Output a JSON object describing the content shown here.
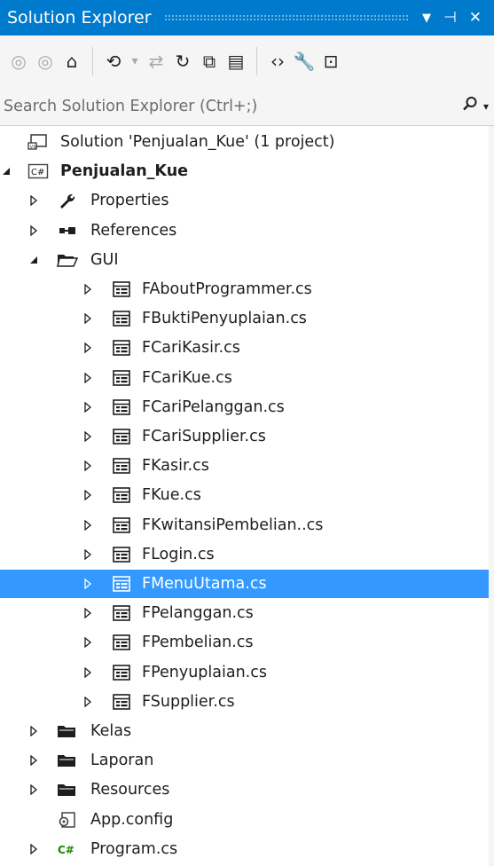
{
  "window": {
    "title": "Solution Explorer",
    "buttons": [
      {
        "name": "dropdown-icon",
        "glyph": "▼"
      },
      {
        "name": "pin-icon",
        "glyph": "⊣"
      },
      {
        "name": "close-icon",
        "glyph": "✕"
      }
    ]
  },
  "toolbar": {
    "items": [
      {
        "name": "back-icon",
        "glyph": "◎",
        "dim": true
      },
      {
        "name": "forward-icon",
        "glyph": "◎",
        "dim": true
      },
      {
        "name": "home-icon",
        "glyph": "⌂",
        "dim": false
      },
      {
        "sep": true
      },
      {
        "name": "pending-changes-filter-icon",
        "glyph": "⟲",
        "dim": false
      },
      {
        "name": "dropdown-arrow-icon",
        "glyph": "▾",
        "dim": true
      },
      {
        "name": "sync-with-document-icon",
        "glyph": "⇄",
        "dim": true
      },
      {
        "name": "refresh-icon",
        "glyph": "↻",
        "dim": false
      },
      {
        "name": "collapse-all-icon",
        "glyph": "⧉",
        "dim": false
      },
      {
        "name": "show-all-files-icon",
        "glyph": "▤",
        "dim": false
      },
      {
        "sep": true
      },
      {
        "name": "view-code-icon",
        "glyph": "‹›",
        "dim": false
      },
      {
        "name": "properties-icon",
        "glyph": "🔧",
        "dim": false
      },
      {
        "name": "preview-icon",
        "glyph": "⊡",
        "dim": false
      }
    ]
  },
  "search": {
    "placeholder": "Search Solution Explorer (Ctrl+;)",
    "value": ""
  },
  "tree": [
    {
      "label": "Solution 'Penjualan_Kue' (1 project)",
      "level": 0,
      "icon": "solution",
      "expander": "none",
      "bold": false,
      "selected": false
    },
    {
      "label": "Penjualan_Kue",
      "level": 0,
      "icon": "csproj",
      "expander": "expanded",
      "bold": true,
      "selected": false
    },
    {
      "label": "Properties",
      "level": 1,
      "icon": "wrench",
      "expander": "collapsed",
      "bold": false,
      "selected": false
    },
    {
      "label": "References",
      "level": 1,
      "icon": "references",
      "expander": "collapsed",
      "bold": false,
      "selected": false
    },
    {
      "label": "GUI",
      "level": 1,
      "icon": "folder-open",
      "expander": "expanded",
      "bold": false,
      "selected": false
    },
    {
      "label": "FAboutProgrammer.cs",
      "level": 2,
      "icon": "form",
      "expander": "collapsed",
      "bold": false,
      "selected": false
    },
    {
      "label": "FBuktiPenyuplaian.cs",
      "level": 2,
      "icon": "form",
      "expander": "collapsed",
      "bold": false,
      "selected": false
    },
    {
      "label": "FCariKasir.cs",
      "level": 2,
      "icon": "form",
      "expander": "collapsed",
      "bold": false,
      "selected": false
    },
    {
      "label": "FCariKue.cs",
      "level": 2,
      "icon": "form",
      "expander": "collapsed",
      "bold": false,
      "selected": false
    },
    {
      "label": "FCariPelanggan.cs",
      "level": 2,
      "icon": "form",
      "expander": "collapsed",
      "bold": false,
      "selected": false
    },
    {
      "label": "FCariSupplier.cs",
      "level": 2,
      "icon": "form",
      "expander": "collapsed",
      "bold": false,
      "selected": false
    },
    {
      "label": "FKasir.cs",
      "level": 2,
      "icon": "form",
      "expander": "collapsed",
      "bold": false,
      "selected": false
    },
    {
      "label": "FKue.cs",
      "level": 2,
      "icon": "form",
      "expander": "collapsed",
      "bold": false,
      "selected": false
    },
    {
      "label": "FKwitansiPembelian..cs",
      "level": 2,
      "icon": "form",
      "expander": "collapsed",
      "bold": false,
      "selected": false
    },
    {
      "label": "FLogin.cs",
      "level": 2,
      "icon": "form",
      "expander": "collapsed",
      "bold": false,
      "selected": false
    },
    {
      "label": "FMenuUtama.cs",
      "level": 2,
      "icon": "form",
      "expander": "collapsed",
      "bold": false,
      "selected": true
    },
    {
      "label": "FPelanggan.cs",
      "level": 2,
      "icon": "form",
      "expander": "collapsed",
      "bold": false,
      "selected": false
    },
    {
      "label": "FPembelian.cs",
      "level": 2,
      "icon": "form",
      "expander": "collapsed",
      "bold": false,
      "selected": false
    },
    {
      "label": "FPenyuplaian.cs",
      "level": 2,
      "icon": "form",
      "expander": "collapsed",
      "bold": false,
      "selected": false
    },
    {
      "label": "FSupplier.cs",
      "level": 2,
      "icon": "form",
      "expander": "collapsed",
      "bold": false,
      "selected": false
    },
    {
      "label": "Kelas",
      "level": 1,
      "icon": "folder",
      "expander": "collapsed",
      "bold": false,
      "selected": false
    },
    {
      "label": "Laporan",
      "level": 1,
      "icon": "folder",
      "expander": "collapsed",
      "bold": false,
      "selected": false
    },
    {
      "label": "Resources",
      "level": 1,
      "icon": "folder",
      "expander": "collapsed",
      "bold": false,
      "selected": false
    },
    {
      "label": "App.config",
      "level": 1,
      "icon": "config",
      "expander": "none",
      "bold": false,
      "selected": false
    },
    {
      "label": "Program.cs",
      "level": 1,
      "icon": "csharp",
      "expander": "collapsed",
      "bold": false,
      "selected": false
    }
  ],
  "colors": {
    "accent": "#007acc",
    "selection": "#3399ff",
    "toolbar_bg": "#f5f5f5"
  }
}
